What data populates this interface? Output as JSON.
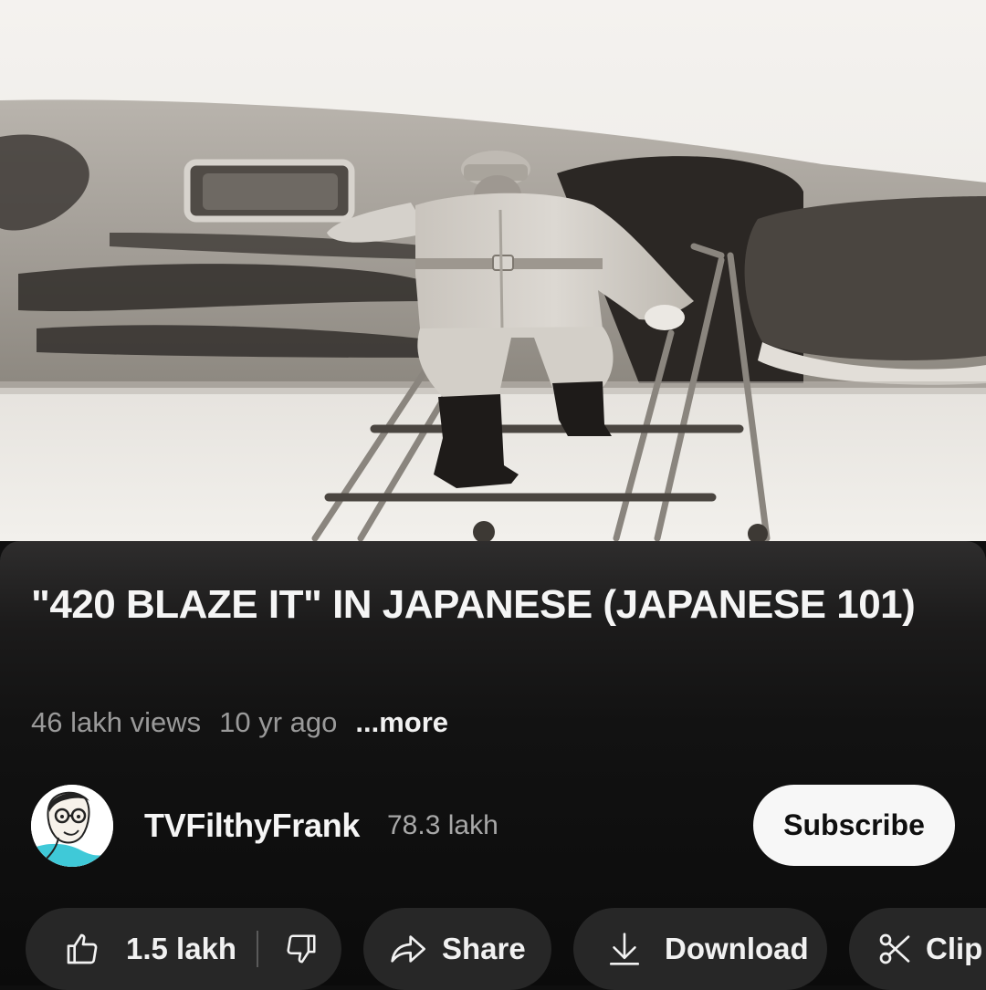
{
  "video": {
    "thumbnail_icon": "video-frame-image"
  },
  "title": "\"420 BLAZE IT\" IN JAPANESE (JAPANESE 101)",
  "meta": {
    "views": "46 lakh views",
    "age": "10 yr ago",
    "more": "...more"
  },
  "channel": {
    "name": "TVFilthyFrank",
    "subscribers": "78.3 lakh",
    "avatar_icon": "channel-avatar",
    "subscribe_label": "Subscribe"
  },
  "actions": {
    "like_count": "1.5 lakh",
    "like_icon": "thumbs-up-icon",
    "dislike_icon": "thumbs-down-icon",
    "share_label": "Share",
    "share_icon": "share-arrow-icon",
    "download_label": "Download",
    "download_icon": "download-arrow-icon",
    "clip_label": "Clip",
    "clip_icon": "scissors-icon"
  },
  "colors": {
    "background": "#0f0f0f",
    "pill": "#272727",
    "subscribe_bg": "#f7f7f7",
    "meta_text": "#9a9a9a"
  }
}
